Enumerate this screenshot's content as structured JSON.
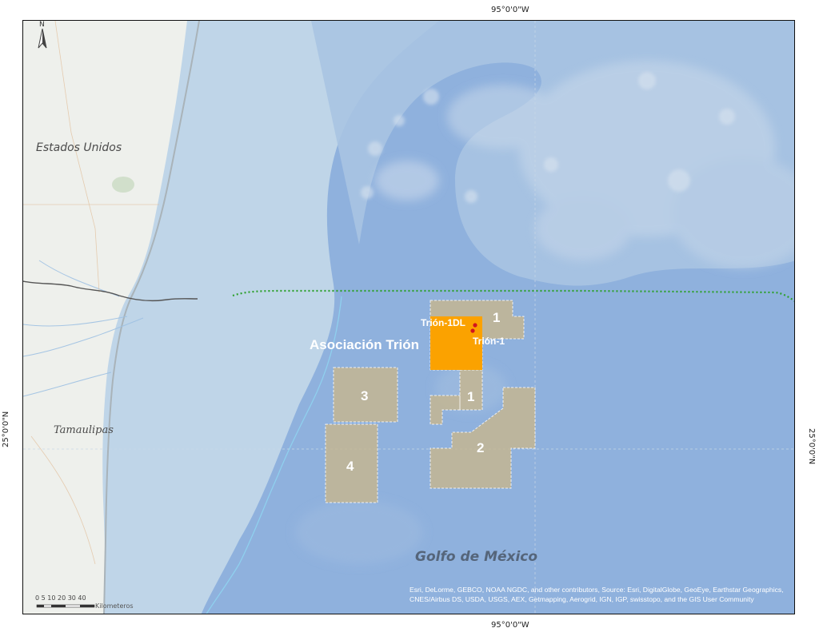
{
  "axis_ticks": {
    "top": "95°0'0\"W",
    "bottom": "95°0'0\"W",
    "left": "25°0'0\"N",
    "right": "25°0'0\"N"
  },
  "labels": {
    "usa": "Estados Unidos",
    "tamaulipas": "Tamaulipas",
    "gulf": "Golfo de México",
    "association": "Asociación Trión",
    "well_1dl": "Trión-1DL",
    "well_1": "Trión-1"
  },
  "blocks": [
    {
      "label": "1"
    },
    {
      "label": "1"
    },
    {
      "label": "2"
    },
    {
      "label": "3"
    },
    {
      "label": "4"
    }
  ],
  "north_arrow": {
    "letter": "N",
    "icon": "north-arrow-icon"
  },
  "scale_bar": {
    "ticks": "0 5 10  20  30  40",
    "unit": "Kilometeros"
  },
  "credits": "Esri, DeLorme, GEBCO, NOAA NGDC, and other contributors, Source: Esri, DigitalGlobe, GeoEye, Earthstar Geographics, CNES/Airbus DS, USDA, USGS, AEX, Getmapping, Aerogrid, IGN, IGP, swisstopo, and the GIS User Community",
  "colors": {
    "land": "#eef0ec",
    "shelf": "#bcd3e6",
    "deep": "#8fb1dd",
    "block_fill": "#c6b68f",
    "trion_block": "#fba200",
    "boundary": "#2ea02e",
    "well": "#d2141e"
  }
}
